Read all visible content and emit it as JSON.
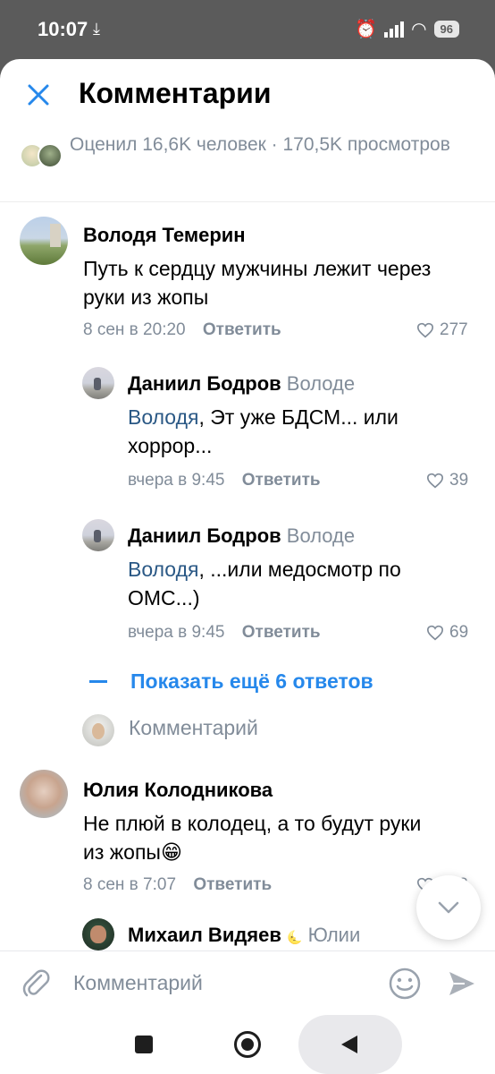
{
  "status_bar": {
    "time": "10:07",
    "battery": "96"
  },
  "header": {
    "title": "Комментарии",
    "stats": "Оценил 16,6K человек · 170,5K просмотров"
  },
  "comments": [
    {
      "author": "Володя Темерин",
      "reply_to": "",
      "mention": "",
      "text": "Путь к сердцу мужчины лежит через руки из жопы",
      "date": "8 сен в 20:20",
      "reply_label": "Ответить",
      "likes": "277"
    },
    {
      "author": "Даниил Бодров",
      "reply_to": "Володе",
      "mention": "Володя",
      "text": ", Эт уже БДСМ... или хоррор...",
      "date": "вчера в 9:45",
      "reply_label": "Ответить",
      "likes": "39"
    },
    {
      "author": "Даниил Бодров",
      "reply_to": "Володе",
      "mention": "Володя",
      "text": ", ...или медосмотр по ОМС...)",
      "date": "вчера в 9:45",
      "reply_label": "Ответить",
      "likes": "69"
    },
    {
      "author": "Юлия Колодникова",
      "reply_to": "",
      "mention": "",
      "text": "Не плюй в колодец, а то будут руки из жопы😁",
      "date": "8 сен в 7:07",
      "reply_label": "Ответить",
      "likes": "268"
    },
    {
      "author": "Михаил Видяев",
      "author_badge": "🌜",
      "reply_to": "Юлии",
      "mention": "",
      "text": "",
      "date": "",
      "reply_label": "",
      "likes": ""
    }
  ],
  "show_more": "Показать ещё 6 ответов",
  "inline_reply_placeholder": "Комментарий",
  "composer": {
    "placeholder": "Комментарий"
  },
  "colors": {
    "accent": "#2688eb",
    "mention": "#2a5885",
    "secondary_text": "#818c99",
    "status_bar": "#5b5b5b"
  },
  "icons": [
    "close-icon",
    "heart-icon",
    "chevron-down-icon",
    "paperclip-icon",
    "emoji-icon",
    "send-icon",
    "download-icon",
    "alarm-icon",
    "signal-icon",
    "wifi-icon"
  ]
}
